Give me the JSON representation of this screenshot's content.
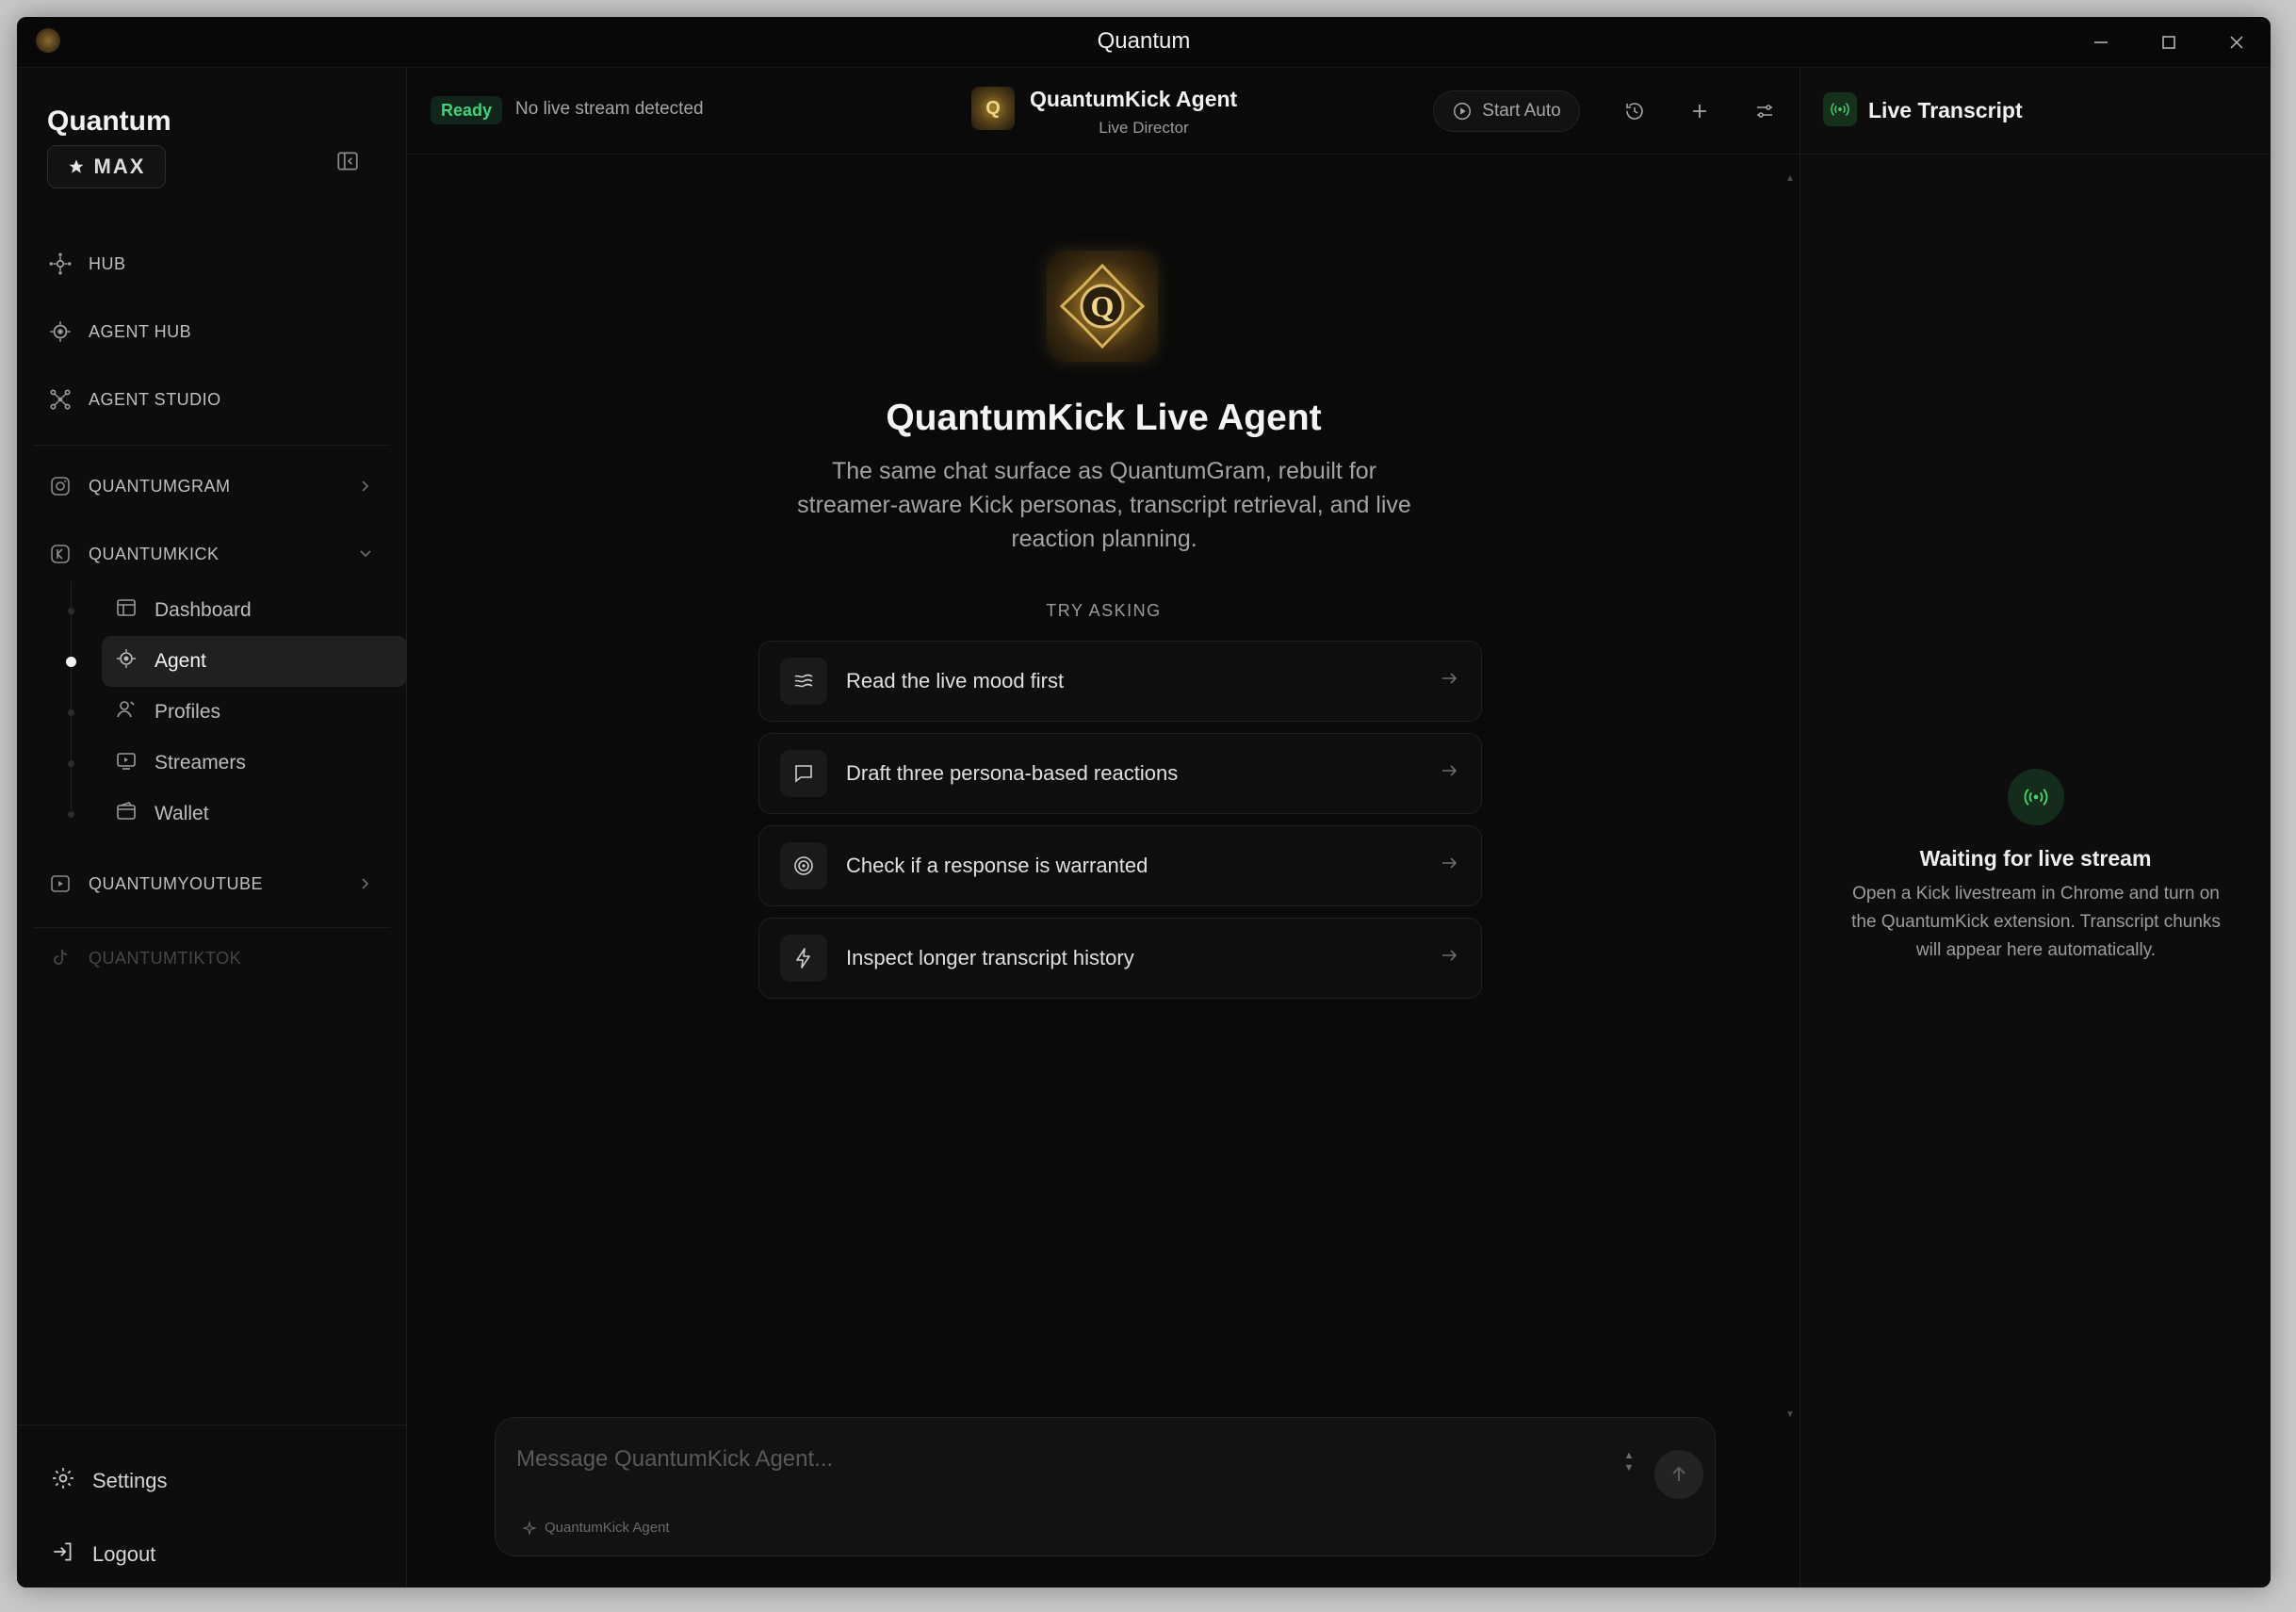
{
  "window": {
    "title": "Quantum",
    "minimize_icon": "minimize-icon",
    "maximize_icon": "maximize-icon",
    "close_icon": "close-icon"
  },
  "sidebar": {
    "brand": "Quantum",
    "plan_badge": "MAX",
    "nav": [
      {
        "label": "HUB",
        "icon": "hub-icon"
      },
      {
        "label": "AGENT HUB",
        "icon": "agent-hub-icon"
      },
      {
        "label": "AGENT STUDIO",
        "icon": "agent-studio-icon"
      }
    ],
    "groups": [
      {
        "label": "QUANTUMGRAM",
        "icon": "instagram-icon",
        "expanded": false
      },
      {
        "label": "QUANTUMKICK",
        "icon": "kick-icon",
        "expanded": true
      },
      {
        "label": "QUANTUMYOUTUBE",
        "icon": "youtube-icon",
        "expanded": false
      },
      {
        "label": "QUANTUMTIKTOK",
        "icon": "tiktok-icon",
        "disabled": true
      }
    ],
    "kick_items": [
      {
        "label": "Dashboard",
        "icon": "dashboard-icon",
        "active": false
      },
      {
        "label": "Agent",
        "icon": "agent-icon",
        "active": true
      },
      {
        "label": "Profiles",
        "icon": "profiles-icon",
        "active": false
      },
      {
        "label": "Streamers",
        "icon": "streamers-icon",
        "active": false
      },
      {
        "label": "Wallet",
        "icon": "wallet-icon",
        "active": false
      }
    ],
    "settings_label": "Settings",
    "logout_label": "Logout"
  },
  "topbar": {
    "status": "Ready",
    "stream_status": "No live stream detected",
    "agent_name": "QuantumKick Agent",
    "agent_role": "Live Director",
    "start_auto_label": "Start Auto"
  },
  "hero": {
    "title": "QuantumKick Live Agent",
    "description": "The same chat surface as QuantumGram, rebuilt for streamer-aware Kick personas, transcript retrieval, and live reaction planning.",
    "try_label": "TRY ASKING"
  },
  "suggestions": [
    {
      "label": "Read the live mood first",
      "icon": "waves-icon"
    },
    {
      "label": "Draft three persona-based reactions",
      "icon": "message-square-icon"
    },
    {
      "label": "Check if a response is warranted",
      "icon": "target-icon"
    },
    {
      "label": "Inspect longer transcript history",
      "icon": "lightning-icon"
    }
  ],
  "composer": {
    "placeholder": "Message QuantumKick Agent...",
    "agent_tag": "QuantumKick Agent"
  },
  "transcript": {
    "title": "Live Transcript",
    "waiting_title": "Waiting for live stream",
    "waiting_desc": "Open a Kick livestream in Chrome and turn on the QuantumKick extension. Transcript chunks will appear here automatically."
  },
  "colors": {
    "accent_green": "#3fd17c",
    "background": "#0b0b0b",
    "active_item": "#202020"
  }
}
